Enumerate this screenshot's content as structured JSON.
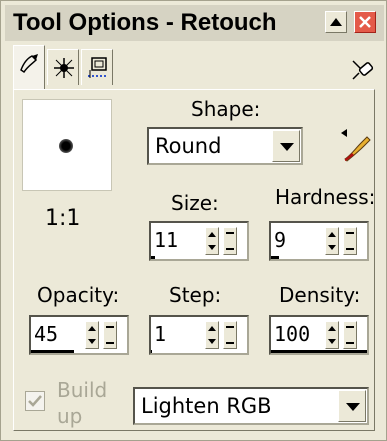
{
  "window": {
    "title": "Tool Options - Retouch"
  },
  "titlebar_buttons": {
    "minimize_icon": "minimize-icon",
    "close_icon": "close-icon"
  },
  "tabs": [
    {
      "name": "retouch-tab",
      "icon": "tool-icon",
      "active": true
    },
    {
      "name": "brush-variance-tab",
      "icon": "brush-variance-icon",
      "active": false
    },
    {
      "name": "overlay-tab",
      "icon": "overlay-icon",
      "active": false
    }
  ],
  "preview": {
    "ratio": "1:1"
  },
  "shape": {
    "label": "Shape:",
    "value": "Round"
  },
  "size": {
    "label": "Size:",
    "value": "11"
  },
  "hardness": {
    "label": "Hardness:",
    "value": "9"
  },
  "opacity": {
    "label": "Opacity:",
    "value": "45"
  },
  "step": {
    "label": "Step:",
    "value": "1"
  },
  "density": {
    "label": "Density:",
    "value": "100"
  },
  "build_up": {
    "label_line1": "Build",
    "label_line2": "up",
    "checked": true,
    "enabled": false
  },
  "mode": {
    "value": "Lighten RGB"
  },
  "colors": {
    "panel_bg": "#ece9d8",
    "title_bg": "#d6d3c3",
    "close_red": "#e45a49",
    "disabled_text": "#a9a796"
  }
}
